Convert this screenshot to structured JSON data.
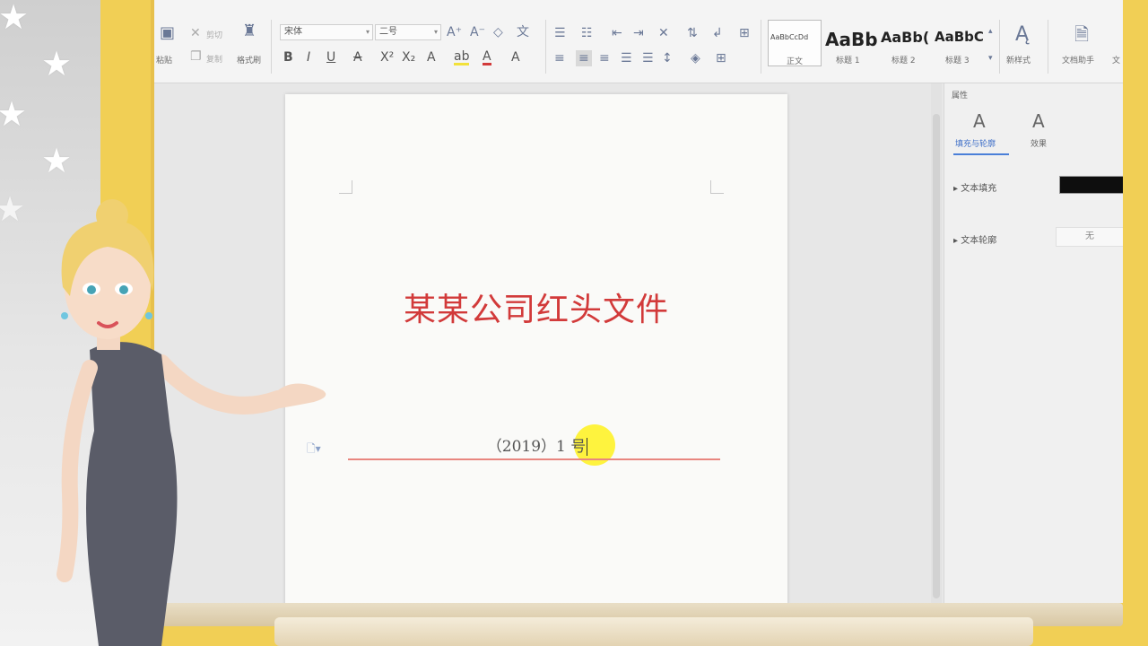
{
  "toolbar": {
    "paste_label": "粘贴",
    "cut_label": "剪切",
    "copy_label": "复制",
    "format_painter_label": "格式刷",
    "font_name": "宋体",
    "font_size": "二号",
    "styles": [
      {
        "sample": "AaBbCcDd",
        "label": "正文"
      },
      {
        "sample": "AaBb",
        "label": "标题 1"
      },
      {
        "sample": "AaBb(",
        "label": "标题 2"
      },
      {
        "sample": "AaBbC",
        "label": "标题 3"
      }
    ],
    "new_style_label": "新样式",
    "doc_helper_label": "文档助手",
    "more_label": "文"
  },
  "document": {
    "title": "某某公司红头文件",
    "number": "（2019）1 号"
  },
  "panel": {
    "title": "属性",
    "tabs": [
      {
        "icon": "A",
        "label": "填充与轮廓"
      },
      {
        "icon": "A",
        "label": "效果"
      }
    ],
    "text_fill_label": "文本填充",
    "text_outline_label": "文本轮廓",
    "text_outline_value": "无",
    "fill_color": "#0e0e0e"
  },
  "colors": {
    "frame": "#f1cf55",
    "title_red": "#d23a3a",
    "rule_red": "#e8867f",
    "accent": "#4a7fd8"
  }
}
